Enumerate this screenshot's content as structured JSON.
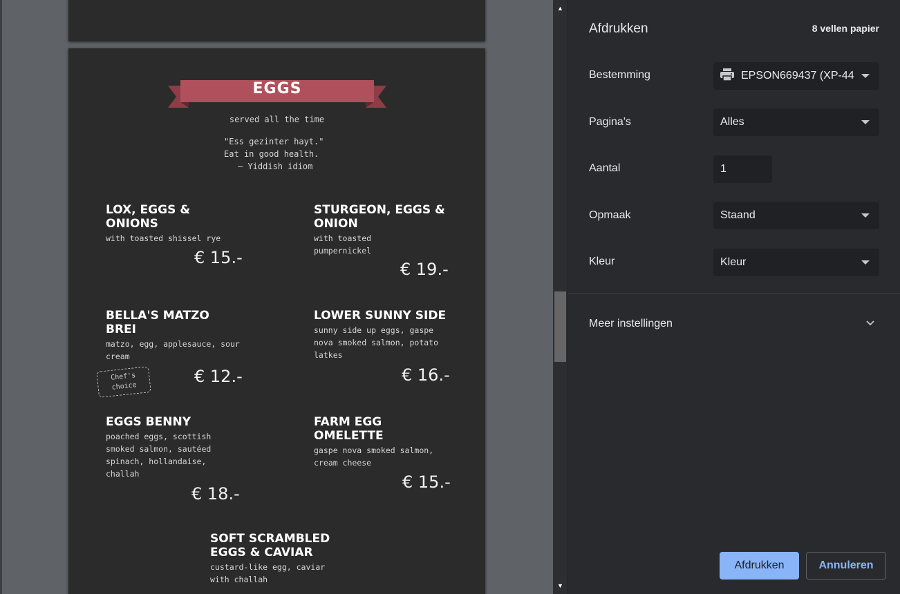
{
  "panel": {
    "title": "Afdrukken",
    "sheets": "8 vellen papier",
    "destination": {
      "label": "Bestemming",
      "value": "EPSON669437 (XP-44",
      "icon": "printer-icon"
    },
    "pages": {
      "label": "Pagina's",
      "value": "Alles"
    },
    "copies": {
      "label": "Aantal",
      "value": "1"
    },
    "layout": {
      "label": "Opmaak",
      "value": "Staand"
    },
    "color": {
      "label": "Kleur",
      "value": "Kleur"
    },
    "more_settings": "Meer instellingen",
    "print_label": "Afdrukken",
    "cancel_label": "Annuleren"
  },
  "menu": {
    "banner_title": "EGGS",
    "subtitle": "served all the time",
    "quote": [
      "\"Ess gezinter hayt.\"",
      "Eat in good health.",
      "— Yiddish idiom"
    ],
    "badge": "Chef's choice",
    "items": [
      {
        "name": "LOX, EGGS & ONIONS",
        "desc": "with toasted shissel rye",
        "price": "€ 15.-"
      },
      {
        "name": "STURGEON, EGGS & ONION",
        "desc": "with toasted pumpernickel",
        "price": "€ 19.-"
      },
      {
        "name": "BELLA'S MATZO BREI",
        "desc": "matzo, egg, applesauce, sour cream",
        "price": "€ 12.-"
      },
      {
        "name": "LOWER SUNNY SIDE",
        "desc": "sunny side up eggs, gaspe nova smoked salmon, potato latkes",
        "price": "€ 16.-"
      },
      {
        "name": "EGGS BENNY",
        "desc": "poached eggs, scottish smoked salmon, sautéed spinach, hollandaise, challah",
        "price": "€ 18.-"
      },
      {
        "name": "FARM EGG OMELETTE",
        "desc": "gaspe nova smoked salmon, cream cheese",
        "price": "€ 15.-"
      },
      {
        "name": "SOFT SCRAMBLED EGGS & CAVIAR",
        "desc": "custard-like egg, caviar with challah",
        "price": ""
      }
    ]
  },
  "colors": {
    "accent": "#8ab4f8",
    "banner": "#b0505c",
    "panel_bg": "#292a2d",
    "page_bg": "#2b2b2b"
  }
}
